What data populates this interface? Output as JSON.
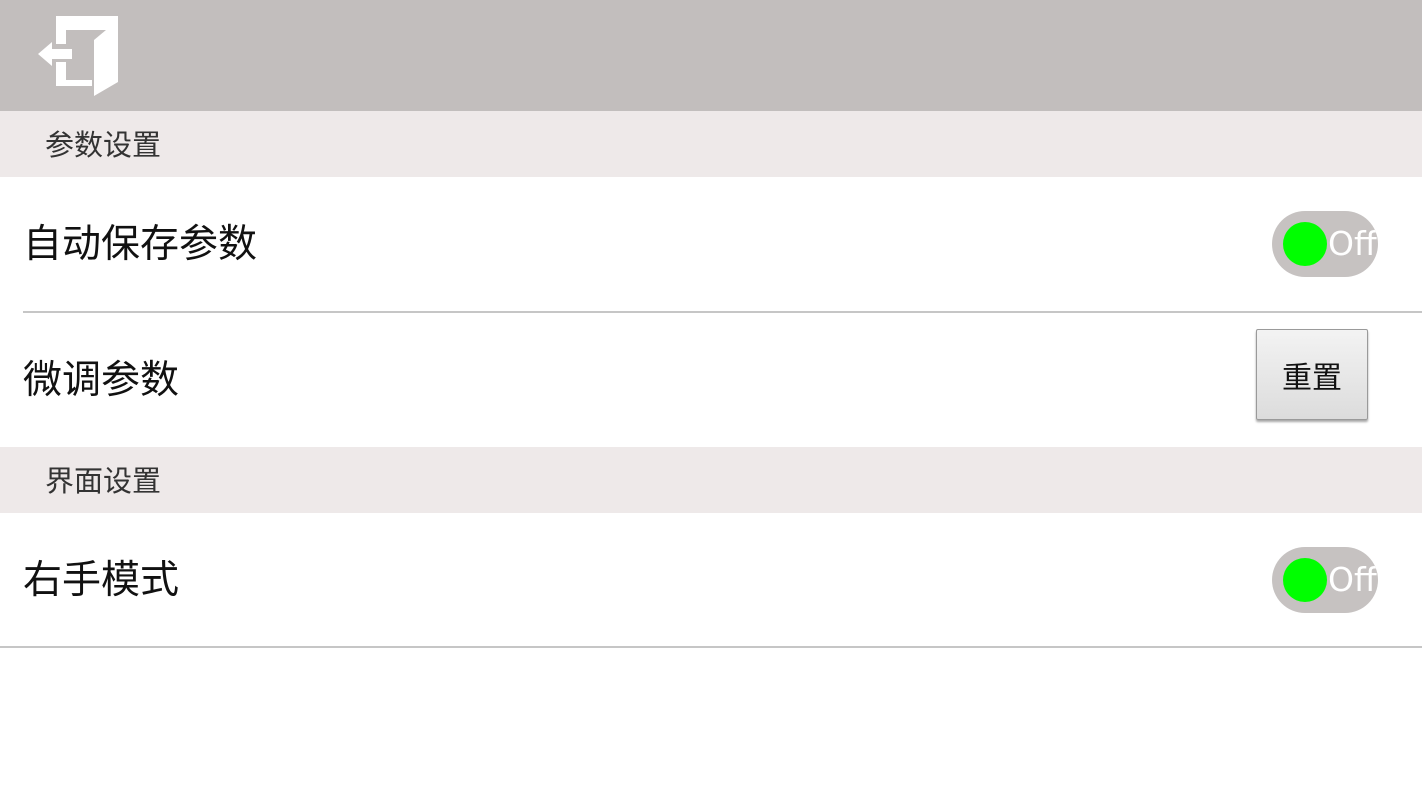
{
  "toolbar": {
    "exit_icon": "exit-door-arrow-left-icon"
  },
  "sections": [
    {
      "title": "参数设置",
      "items": [
        {
          "label": "自动保存参数",
          "control": "toggle",
          "toggle_text": "Off",
          "knob_color": "#00ff00"
        },
        {
          "label": "微调参数",
          "control": "button",
          "button_label": "重置"
        }
      ]
    },
    {
      "title": "界面设置",
      "items": [
        {
          "label": "右手模式",
          "control": "toggle",
          "toggle_text": "Off",
          "knob_color": "#00ff00"
        }
      ]
    }
  ],
  "colors": {
    "topbar": "#c2bebd",
    "section_header": "#eee9e9",
    "toggle_track": "#c6c2c1",
    "toggle_knob": "#00ff00"
  }
}
